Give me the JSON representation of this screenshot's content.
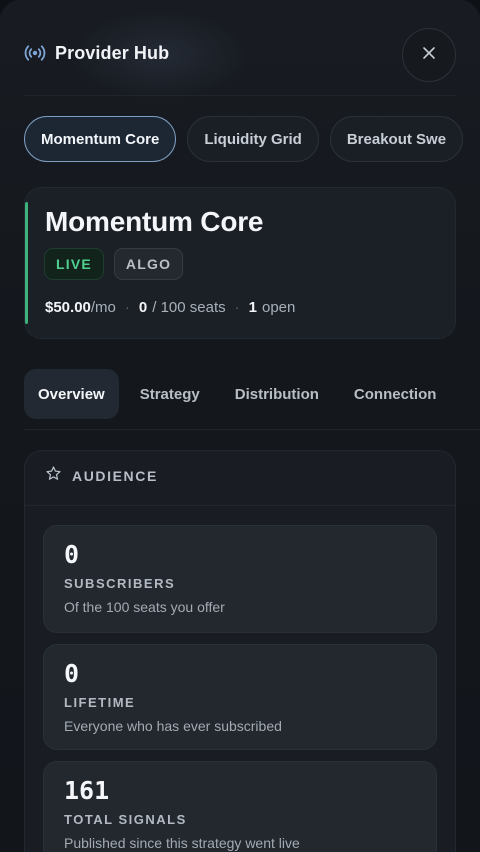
{
  "header": {
    "title": "Provider Hub",
    "icon": "broadcast-signal-icon",
    "close_icon": "close-icon"
  },
  "provider_pills": [
    {
      "label": "Momentum Core",
      "active": true
    },
    {
      "label": "Liquidity Grid",
      "active": false
    },
    {
      "label": "Breakout Swe",
      "active": false
    }
  ],
  "provider": {
    "name": "Momentum Core",
    "status_badge": "LIVE",
    "type_badge": "ALGO",
    "price": "$50.00",
    "price_unit": "/mo",
    "seats_used": "0",
    "seats_total": "/ 100 seats",
    "open_count": "1",
    "open_label": "open",
    "separator": "·",
    "accent_color": "#3eb27b"
  },
  "tabs": [
    {
      "label": "Overview",
      "active": true
    },
    {
      "label": "Strategy",
      "active": false
    },
    {
      "label": "Distribution",
      "active": false
    },
    {
      "label": "Connection",
      "active": false
    }
  ],
  "audience": {
    "title": "AUDIENCE",
    "icon": "star-icon",
    "stats": [
      {
        "value": "0",
        "name": "SUBSCRIBERS",
        "desc": "Of the 100 seats you offer"
      },
      {
        "value": "0",
        "name": "LIFETIME",
        "desc": "Everyone who has ever subscribed"
      },
      {
        "value": "161",
        "name": "TOTAL SIGNALS",
        "desc": "Published since this strategy went live"
      }
    ]
  }
}
